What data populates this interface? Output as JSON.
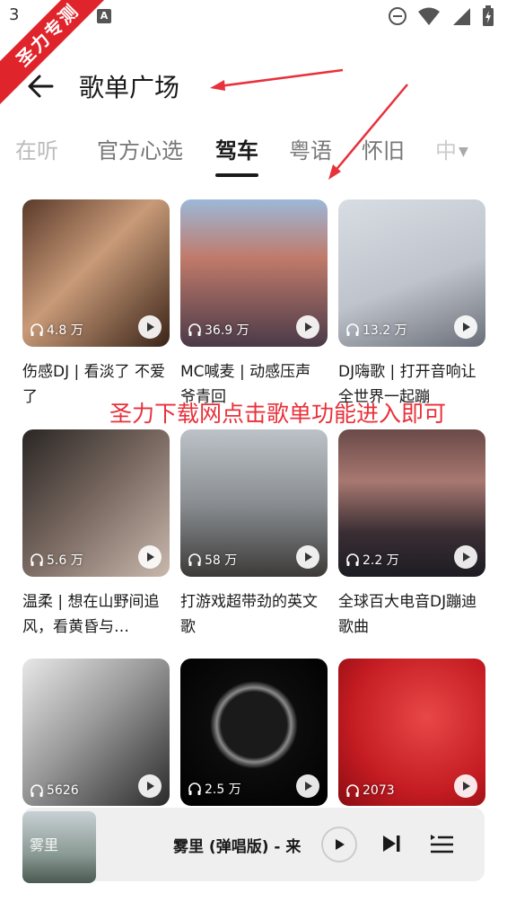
{
  "status_bar": {
    "time": "3",
    "icons": [
      "a-notification-icon",
      "do-not-disturb-icon",
      "wifi-icon",
      "signal-icon",
      "battery-charging-icon"
    ]
  },
  "watermark": {
    "text": "圣力专测"
  },
  "header": {
    "title": "歌单广场",
    "back_icon": "arrow-left-icon"
  },
  "tabs": [
    {
      "label": "在听"
    },
    {
      "label": "官方心选"
    },
    {
      "label": "驾车",
      "active": true
    },
    {
      "label": "粤语"
    },
    {
      "label": "怀旧"
    },
    {
      "label": "中"
    }
  ],
  "playlists": [
    {
      "title": "伤感DJ | 看淡了 不爱了",
      "plays": "4.8 万"
    },
    {
      "title": "MC喊麦 | 动感压声爷青回",
      "plays": "36.9 万"
    },
    {
      "title": "DJ嗨歌 | 打开音响让全世界一起蹦",
      "plays": "13.2 万"
    },
    {
      "title": "温柔 | 想在山野间追风，看黄昏与…",
      "plays": "5.6 万"
    },
    {
      "title": "打游戏超带劲的英文歌",
      "plays": "58 万"
    },
    {
      "title": "全球百大电音DJ蹦迪歌曲",
      "plays": "2.2 万"
    },
    {
      "title": "",
      "plays": "5626"
    },
    {
      "title": "",
      "plays": "2.5 万"
    },
    {
      "title": "",
      "plays": "2073"
    }
  ],
  "annotation": {
    "text": "圣力下载网点击歌单功能进入即可",
    "color": "#e8313a"
  },
  "mini_player": {
    "title": "雾里 (弹唱版) - 来",
    "thumb_text": "雾里"
  },
  "colors": {
    "accent_red": "#e0242b",
    "text_dark": "#1a1a1a",
    "tab_inactive": "#777777",
    "player_bg": "#efefef"
  }
}
